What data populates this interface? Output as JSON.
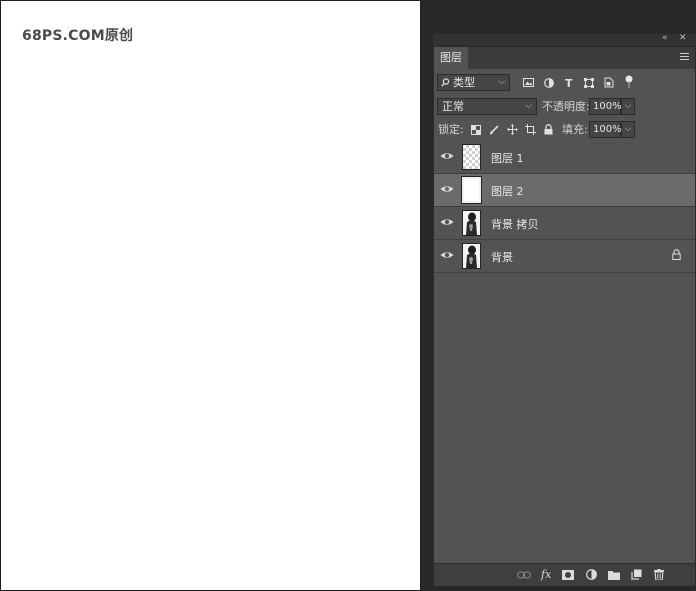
{
  "watermark": "68PS.COM原创",
  "panel": {
    "tab_label": "图层",
    "collapse_arrows": "«",
    "close": "✕",
    "filter": {
      "search_icon": "magnifier-icon",
      "kind_label": "类型",
      "icons": [
        "image-filter-icon",
        "adjustment-filter-icon",
        "type-filter-icon",
        "shape-filter-icon",
        "smart-object-filter-icon",
        "filter-toggle-icon"
      ]
    },
    "blend": {
      "mode": "正常",
      "opacity_label": "不透明度:",
      "opacity_value": "100%"
    },
    "lock": {
      "label": "锁定:",
      "fill_label": "填充:",
      "fill_value": "100%"
    },
    "layers": [
      {
        "name": "图层 1",
        "thumb": "transparent",
        "selected": false,
        "locked": false
      },
      {
        "name": "图层 2",
        "thumb": "white",
        "selected": true,
        "locked": false
      },
      {
        "name": "背景 拷贝",
        "thumb": "photo",
        "selected": false,
        "locked": false
      },
      {
        "name": "背景",
        "thumb": "photo",
        "selected": false,
        "locked": true
      }
    ],
    "bottom_icons": [
      "link-layers-icon",
      "fx-icon",
      "mask-icon",
      "adjustment-icon",
      "group-folder-icon",
      "new-layer-icon",
      "trash-icon"
    ]
  }
}
